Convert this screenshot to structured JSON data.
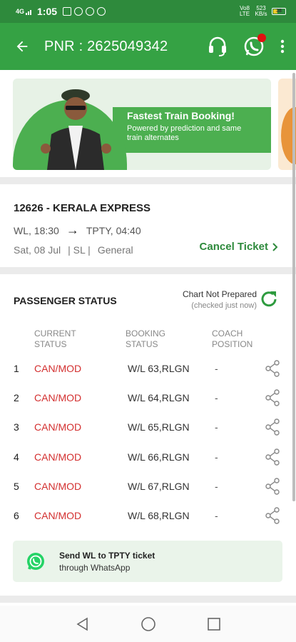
{
  "status_bar": {
    "network": "4G",
    "time": "1:05",
    "volte": "Vo8 LTE",
    "speed": "523 KB/s",
    "battery": "38",
    "battery_fraction": 0.38
  },
  "app_bar": {
    "title": "PNR : 2625049342",
    "icons": [
      "back-arrow-icon",
      "headset-icon",
      "whatsapp-icon",
      "more-vert-icon"
    ]
  },
  "banner": {
    "title": "Fastest Train Booking!",
    "subtitle": "Powered by prediction and same train alternates"
  },
  "train": {
    "name": "12626 - KERALA EXPRESS",
    "from": "WL, 18:30",
    "to": "TPTY, 04:40",
    "date": "Sat, 08 Jul",
    "class": "| SL |",
    "quota": "General",
    "cancel_label": "Cancel Ticket"
  },
  "passengers": {
    "title": "PASSENGER STATUS",
    "chart_status": "Chart Not Prepared",
    "checked": "(checked just now)",
    "headers": {
      "current": "CURRENT STATUS",
      "booking": "BOOKING STATUS",
      "coach": "COACH POSITION"
    },
    "rows": [
      {
        "no": "1",
        "current": "CAN/MOD",
        "booking": "W/L  63,RLGN",
        "coach": "-"
      },
      {
        "no": "2",
        "current": "CAN/MOD",
        "booking": "W/L  64,RLGN",
        "coach": "-"
      },
      {
        "no": "3",
        "current": "CAN/MOD",
        "booking": "W/L  65,RLGN",
        "coach": "-"
      },
      {
        "no": "4",
        "current": "CAN/MOD",
        "booking": "W/L  66,RLGN",
        "coach": "-"
      },
      {
        "no": "5",
        "current": "CAN/MOD",
        "booking": "W/L  67,RLGN",
        "coach": "-"
      },
      {
        "no": "6",
        "current": "CAN/MOD",
        "booking": "W/L  68,RLGN",
        "coach": "-"
      }
    ]
  },
  "whatsapp": {
    "line1": "Send WL to TPTY ticket",
    "line2": "through WhatsApp"
  },
  "colors": {
    "primary": "#35a244",
    "status_bar": "#2e8a3c",
    "cancelled_red": "#d32f2f",
    "whatsapp_green": "#25d366"
  }
}
